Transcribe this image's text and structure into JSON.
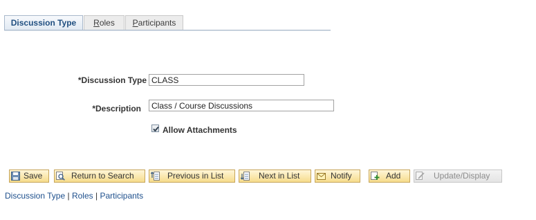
{
  "tabs": [
    {
      "label": "Discussion Type",
      "active": true
    },
    {
      "label": "Roles",
      "underline_first": "R",
      "rest": "oles"
    },
    {
      "label": "Participants",
      "underline_first": "P",
      "rest": "articipants"
    }
  ],
  "form": {
    "discussion_type_label": "*Discussion Type",
    "discussion_type_value": "CLASS",
    "description_label": "*Description",
    "description_value": "Class / Course Discussions",
    "allow_attachments_label": "Allow Attachments",
    "allow_attachments_checked": true
  },
  "toolbar": {
    "save": "Save",
    "return_to_search": "Return to Search",
    "previous_in_list": "Previous in List",
    "next_in_list": "Next in List",
    "notify": "Notify",
    "add": "Add",
    "update_display": "Update/Display"
  },
  "footer_links": {
    "discussion_type": "Discussion Type",
    "sep1": " | ",
    "roles": "Roles",
    "sep2": " | ",
    "participants": "Participants"
  },
  "colors": {
    "link": "#1d4f8c",
    "button_border": "#c6a55a",
    "tab_active_text": "#204f80"
  }
}
